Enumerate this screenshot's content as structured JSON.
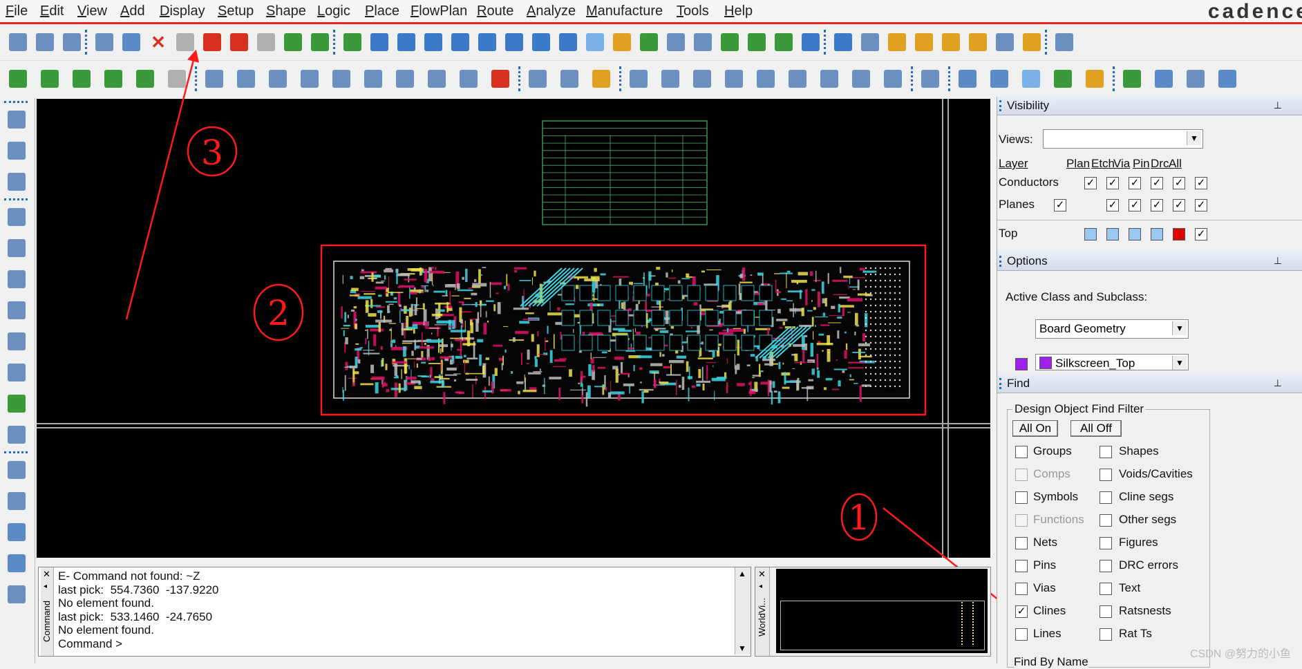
{
  "menu": [
    "File",
    "Edit",
    "View",
    "Add",
    "Display",
    "Setup",
    "Shape",
    "Logic",
    "Place",
    "FlowPlan",
    "Route",
    "Analyze",
    "Manufacture",
    "Tools",
    "Help"
  ],
  "brand": "cadence",
  "toolbar1_icons": [
    "new-file-icon",
    "open-folder-icon",
    "save-icon",
    "move-icon",
    "copy-icon",
    "delete-icon",
    "undo-icon",
    "redo-down-icon",
    "redo-icon",
    "step-down-icon",
    "shape-icon",
    "pin-icon",
    "grid-view-icon",
    "grid-zoom-icon",
    "zoom-fit-icon",
    "zoom-window-icon",
    "zoom-in-icon",
    "zoom-out-icon",
    "zoom-previous-icon",
    "zoom-world-icon",
    "refresh-icon",
    "3d-view-icon",
    "flip-icon",
    "grid-icon",
    "color-icon",
    "layers-icon",
    "stack-icon",
    "em-icon",
    "dfa-icon",
    "world-icon",
    "info-icon",
    "properties-icon",
    "measure-123-icon",
    "brush-icon",
    "sun-icon",
    "sun-dim-icon",
    "columns-icon",
    "timer-icon",
    "no-cross-icon"
  ],
  "toolbar2_icons": [
    "board-select-icon",
    "board-green-icon",
    "board-route-icon",
    "board-fit-icon",
    "board-check-icon",
    "gray-box-icon",
    "line-corner-icon",
    "rectangle-icon",
    "circle-icon",
    "arrow-select-icon",
    "frame-icon",
    "rotate-icon",
    "square-icon",
    "ring-icon",
    "polygon-icon",
    "delete-red-icon",
    "component-icon",
    "dimension-icon",
    "measure-icon",
    "ode-icon",
    "connector-icon",
    "via-icon",
    "camera-icon",
    "refdes-icon",
    "flag-icon",
    "matrix-icon",
    "target-icon",
    "array-icon",
    "trace-icon",
    "doc-new-icon",
    "home-icon",
    "box-3d-icon",
    "checklist-icon",
    "wand-icon",
    "copy-stack-icon",
    "mail-icon",
    "envelope-icon",
    "help-icon"
  ],
  "left_icons": [
    "place-manual-icon",
    "u1-icon",
    "connector-cd-icon",
    "add-connect-icon",
    "slide-icon",
    "delay-tune-icon",
    "fanout-icon",
    "bus-route-icon",
    "align-icon",
    "matrix-grid-icon",
    "phase-tune-icon",
    "line-icon",
    "rect-icon",
    "text-add-icon",
    "text-edit-icon",
    "route-cross-icon"
  ],
  "command": {
    "lines": [
      "E- Command not found: ~Z",
      "last pick:  554.7360  -137.9220",
      "No element found.",
      "last pick:  533.1460  -24.7650",
      "No element found.",
      "Command >"
    ],
    "label": "Command"
  },
  "worldview": {
    "label": "WorldVi..."
  },
  "visibility": {
    "title": "Visibility",
    "views_label": "Views:",
    "views_value": "",
    "headers": [
      "Layer",
      "Plan",
      "Etch",
      "Via",
      "Pin",
      "Drc",
      "All"
    ],
    "rows": [
      {
        "name": "Conductors",
        "checks": [
          "x",
          "x",
          "x",
          "x",
          "x"
        ]
      },
      {
        "name": "Planes",
        "checks": [
          "x",
          "x",
          "x",
          "x",
          "x"
        ]
      },
      {
        "name": "Top",
        "colors": [
          "#9cc8ef",
          "#9cc8ef",
          "#9cc8ef",
          "#9cc8ef",
          "#e00000"
        ],
        "all": "x"
      }
    ]
  },
  "options": {
    "title": "Options",
    "active_label": "Active Class and Subclass:",
    "class_value": "Board Geometry",
    "subclass_value": "Silkscreen_Top",
    "subclass_color": "#a020f0"
  },
  "find": {
    "title": "Find",
    "group_label": "Design Object Find Filter",
    "all_on": "All On",
    "all_off": "All Off",
    "left": [
      {
        "label": "Groups",
        "checked": false,
        "disabled": false
      },
      {
        "label": "Comps",
        "checked": false,
        "disabled": true
      },
      {
        "label": "Symbols",
        "checked": false,
        "disabled": false
      },
      {
        "label": "Functions",
        "checked": false,
        "disabled": true
      },
      {
        "label": "Nets",
        "checked": false,
        "disabled": false
      },
      {
        "label": "Pins",
        "checked": false,
        "disabled": false
      },
      {
        "label": "Vias",
        "checked": false,
        "disabled": false
      },
      {
        "label": "Clines",
        "checked": true,
        "disabled": false
      },
      {
        "label": "Lines",
        "checked": false,
        "disabled": false
      }
    ],
    "right": [
      {
        "label": "Shapes",
        "checked": false
      },
      {
        "label": "Voids/Cavities",
        "checked": false
      },
      {
        "label": "Cline segs",
        "checked": false
      },
      {
        "label": "Other segs",
        "checked": false
      },
      {
        "label": "Figures",
        "checked": false
      },
      {
        "label": "DRC errors",
        "checked": false
      },
      {
        "label": "Text",
        "checked": false
      },
      {
        "label": "Ratsnests",
        "checked": false
      },
      {
        "label": "Rat Ts",
        "checked": false
      }
    ],
    "find_by_name": "Find By Name"
  },
  "annotations": [
    "1",
    "2",
    "3"
  ],
  "watermark": "CSDN @努力的小鱼",
  "colors": {
    "annotation": "#ff1a1a",
    "board_cyan": "#3cd8e6",
    "board_pink": "#e0106a",
    "board_yellow": "#f2e24a",
    "table_green": "#4fb06a"
  }
}
